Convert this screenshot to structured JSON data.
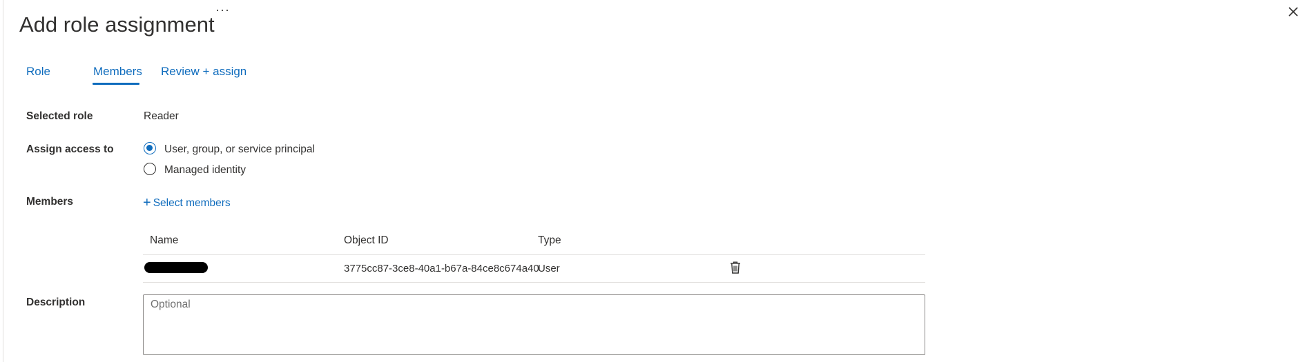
{
  "header": {
    "title": "Add role assignment",
    "more_label": "···"
  },
  "tabs": [
    {
      "label": "Role",
      "active": false
    },
    {
      "label": "Members",
      "active": true
    },
    {
      "label": "Review + assign",
      "active": false
    }
  ],
  "form": {
    "selected_role": {
      "label": "Selected role",
      "value": "Reader"
    },
    "assign_access": {
      "label": "Assign access to",
      "options": [
        {
          "label": "User, group, or service principal",
          "checked": true
        },
        {
          "label": "Managed identity",
          "checked": false
        }
      ]
    },
    "members": {
      "label": "Members",
      "select_label": "Select members",
      "columns": [
        "Name",
        "Object ID",
        "Type"
      ],
      "rows": [
        {
          "name": "[redacted]",
          "object_id": "3775cc87-3ce8-40a1-b67a-84ce8c674a40",
          "type": "User"
        }
      ]
    },
    "description": {
      "label": "Description",
      "placeholder": "Optional",
      "value": ""
    }
  },
  "colors": {
    "accent": "#0f6cbd",
    "text": "#323130",
    "border": "#8a8886",
    "divider": "#e1dfdd"
  },
  "icons": {
    "close": "close-icon",
    "delete": "trash-icon",
    "add": "plus-icon"
  }
}
